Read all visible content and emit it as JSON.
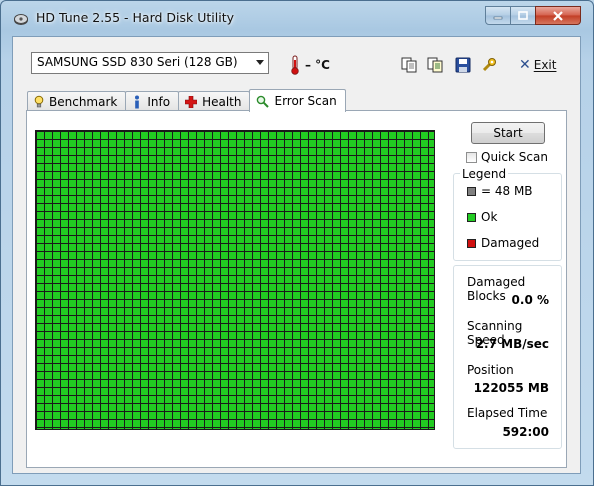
{
  "window": {
    "title": "HD Tune 2.55 - Hard Disk Utility"
  },
  "toolbar": {
    "drive": "SAMSUNG SSD 830 Seri (128 GB)",
    "temperature": "– °C",
    "exit_label": "Exit"
  },
  "tabs": [
    {
      "label": "Benchmark",
      "icon": "bulb-icon"
    },
    {
      "label": "Info",
      "icon": "info-icon"
    },
    {
      "label": "Health",
      "icon": "health-cross-icon"
    },
    {
      "label": "Error Scan",
      "icon": "magnifier-icon",
      "active": true
    }
  ],
  "controls": {
    "start_label": "Start",
    "quick_scan_label": "Quick Scan",
    "quick_scan_checked": false
  },
  "legend": {
    "title": "Legend",
    "items": [
      {
        "label": "= 48 MB",
        "color": "#808080"
      },
      {
        "label": "Ok",
        "color": "#22cc22"
      },
      {
        "label": "Damaged",
        "color": "#d01010"
      }
    ]
  },
  "stats": {
    "damaged_blocks_label": "Damaged Blocks",
    "damaged_blocks_value": "0.0 %",
    "scanning_speed_label": "Scanning Speed",
    "scanning_speed_value": "2.7 MB/sec",
    "position_label": "Position",
    "position_value": "122055 MB",
    "elapsed_label": "Elapsed Time",
    "elapsed_value": "592:00"
  },
  "scan_grid": {
    "status": "ok",
    "block_color": "#22cc22"
  }
}
